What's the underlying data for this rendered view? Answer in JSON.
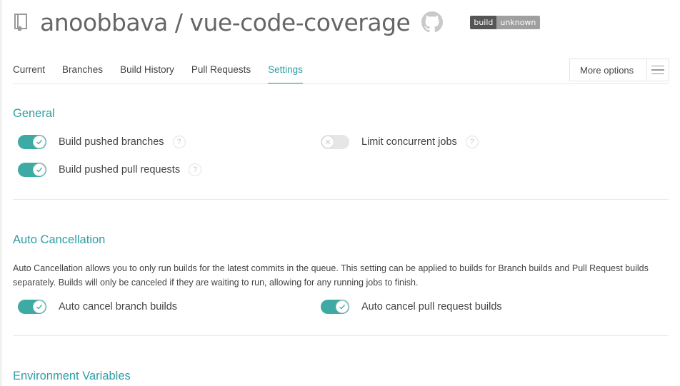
{
  "header": {
    "repo_title": "anoobbava / vue-code-coverage",
    "badge_left": "build",
    "badge_right": "unknown"
  },
  "tabs": [
    {
      "label": "Current",
      "active": false
    },
    {
      "label": "Branches",
      "active": false
    },
    {
      "label": "Build History",
      "active": false
    },
    {
      "label": "Pull Requests",
      "active": false
    },
    {
      "label": "Settings",
      "active": true
    }
  ],
  "more_options": {
    "label": "More options"
  },
  "general": {
    "title": "General",
    "settings": [
      {
        "label": "Build pushed branches",
        "enabled": true,
        "help": "?"
      },
      {
        "label": "Build pushed pull requests",
        "enabled": true,
        "help": "?"
      },
      {
        "label": "Limit concurrent jobs",
        "enabled": false,
        "help": "?"
      }
    ]
  },
  "auto_cancellation": {
    "title": "Auto Cancellation",
    "description": "Auto Cancellation allows you to only run builds for the latest commits in the queue. This setting can be applied to builds for Branch builds and Pull Request builds separately. Builds will only be canceled if they are waiting to run, allowing for any running jobs to finish.",
    "settings": [
      {
        "label": "Auto cancel branch builds",
        "enabled": true
      },
      {
        "label": "Auto cancel pull request builds",
        "enabled": true
      }
    ]
  },
  "environment_variables": {
    "title": "Environment Variables"
  },
  "colors": {
    "accent": "#2e9fa4",
    "toggle_on": "#3eaaa4",
    "toggle_off": "#e6e6e6"
  },
  "icons": {
    "repo": "repo-book-icon",
    "github": "github-octocat-icon",
    "menu": "hamburger-menu-icon",
    "check": "check-icon",
    "cross": "x-icon",
    "help": "question-mark-icon"
  }
}
